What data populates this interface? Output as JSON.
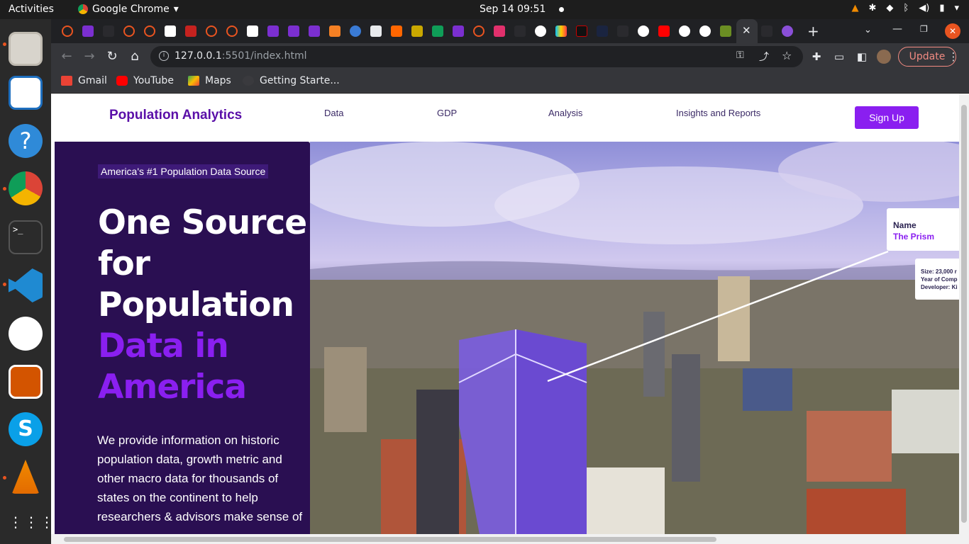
{
  "system_bar": {
    "activities": "Activities",
    "app_name": "Google Chrome",
    "clock": "Sep 14  09:51"
  },
  "dock": {
    "items": [
      "files-icon",
      "writer-icon",
      "help-icon",
      "chrome-icon",
      "terminal-icon",
      "vscode-icon",
      "slack-icon",
      "impress-icon",
      "skype-icon",
      "vlc-icon",
      "show-apps-icon"
    ]
  },
  "browser": {
    "url_host": "127.0.0.1",
    "url_path": ":5501/index.html",
    "update_label": "Update",
    "bookmarks": [
      "Gmail",
      "YouTube",
      "Maps",
      "Getting Starte..."
    ]
  },
  "page": {
    "brand": "Population Analytics",
    "nav": [
      "Data",
      "GDP",
      "Analysis",
      "Insights and Reports"
    ],
    "signup": "Sign Up",
    "tagline": "America's #1 Population Data Source",
    "headline_plain": [
      "One Source",
      "for",
      "Population"
    ],
    "headline_accent": [
      "Data in",
      "America"
    ],
    "description": "We provide information on historic population data, growth metric and other macro data for thousands of states on the continent to help researchers & advisors make sense of",
    "image_callout": {
      "name_label": "Name",
      "name_value": "The Prism",
      "details_text": "Size: 23,000 Year of Comp Developer: Ki",
      "details_lines": [
        "Size: 23,000 r",
        "Year of Comp",
        "Developer: Ki"
      ]
    }
  },
  "colors": {
    "brand": "#5a0fa8",
    "accent": "#8a1ff0",
    "hero_bg": "#2a0f52"
  }
}
